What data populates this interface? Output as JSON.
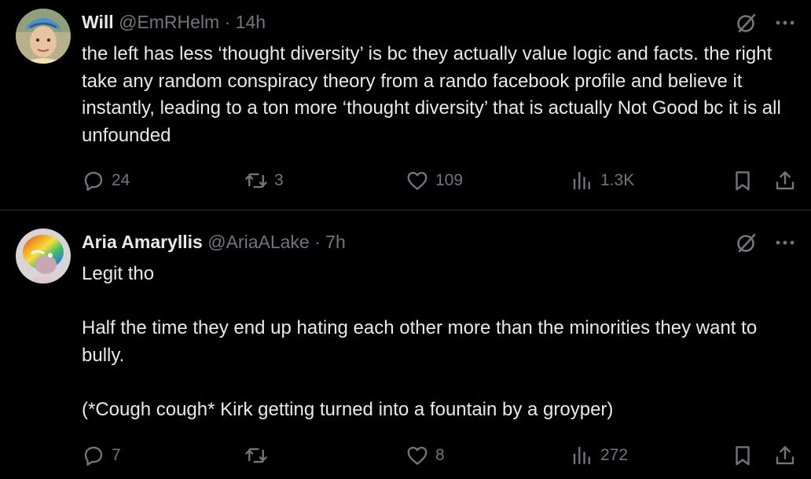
{
  "colors": {
    "background": "#000000",
    "text": "#e7e9ea",
    "muted": "#71767b",
    "divider": "#2f3336"
  },
  "icons": {
    "reply": "reply-bubble-icon",
    "repost": "repost-arrows-icon",
    "like": "heart-icon",
    "views": "bar-chart-icon",
    "bookmark": "bookmark-icon",
    "share": "share-upload-icon",
    "grok": "grok-slash-icon",
    "more": "more-dots-icon"
  },
  "tweets": [
    {
      "name": "Will",
      "handle": "@EmRHelm",
      "separator": "·",
      "time": "14h",
      "text": [
        "the left has less ‘thought diversity’ is bc they actually value logic and facts. the right take any random conspiracy theory from a rando facebook profile and believe it instantly, leading to a ton more ‘thought diversity’ that is actually Not Good bc it is all unfounded"
      ],
      "replies": "24",
      "reposts": "3",
      "likes": "109",
      "views": "1.3K"
    },
    {
      "name": "Aria Amaryllis",
      "handle": "@AriaALake",
      "separator": "·",
      "time": "7h",
      "text": [
        "Legit tho",
        "Half the time they end up hating each other more than the minorities they want to bully.",
        "(*Cough cough* Kirk getting turned into a fountain by a groyper)"
      ],
      "replies": "7",
      "reposts": "",
      "likes": "8",
      "views": "272"
    }
  ]
}
